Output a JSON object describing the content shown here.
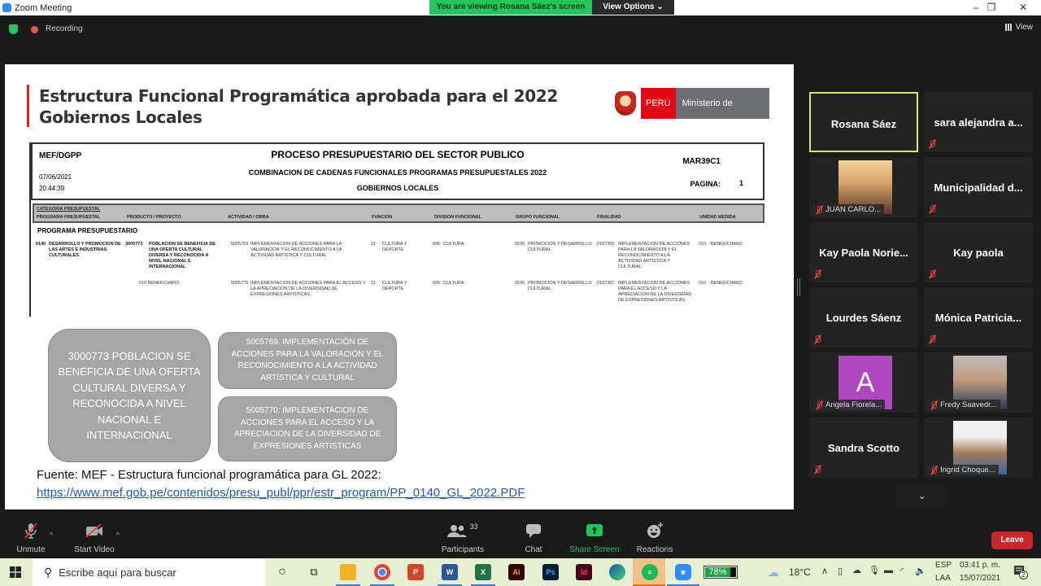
{
  "window": {
    "title": "Zoom Meeting",
    "minimize": "–",
    "restore": "❐",
    "close": "✕"
  },
  "banner": {
    "viewing": "You are viewing Rosana Sáez's screen",
    "view_options": "View Options ⌄"
  },
  "topbar": {
    "recording": "Recording",
    "view": "View"
  },
  "slide": {
    "title_line1": "Estructura Funcional Programática aprobada para el 2022",
    "title_line2": "Gobiernos Locales",
    "logo_peru": "PERÚ",
    "logo_ministry": "Ministerio de Cultura",
    "report": {
      "org": "MEF/DGPP",
      "date": "07/06/2021",
      "time": "20:44:39",
      "title": "PROCESO PRESUPUESTARIO DEL SECTOR PUBLICO",
      "subtitle": "COMBINACION DE CADENAS FUNCIONALES PROGRAMAS PRESUPUESTALES 2022",
      "subtitle2": "GOBIERNOS LOCALES",
      "code": "MAR39C1",
      "page_label": "PAGINA:",
      "page_number": "1"
    },
    "table_headers": {
      "categoria": "CATEGORIA PRESUPUESTAL",
      "programa": "PROGRAMA PRESUPUESTAL",
      "producto": "PRODUCTO / PROYECTO",
      "actividad": "ACTIVIDAD / OBRA",
      "funcion": "FUNCION",
      "division": "DIVISION FUNCIONAL",
      "grupo": "GRUPO FUNCIONAL",
      "finalidad": "FINALIDAD",
      "unidad": "UNIDAD MEDIDA"
    },
    "section_label": "PROGRAMA PRESUPUESTARIO",
    "rows": [
      {
        "prog_code": "0140",
        "prog_name": "DESARROLLO Y PROMOCION DE LAS ARTES E INDUSTRIAS CULTURALES",
        "prod_code": "3000773",
        "prod_name": "POBLACION SE BENEFICIA DE UNA OFERTA CULTURAL DIVERSA Y RECONOCIDA A NIVEL NACIONAL E INTERNACIONAL",
        "act_code": "5005769",
        "act_name": "IMPLEMENTACION DE ACCIONES PARA LA VALORACION Y EL RECONOCIMENTO A LA ACTIVIDAD ARTISTICA Y CULTURAL",
        "func_code": "21",
        "func_name": "CULTURA Y DEPORTE",
        "div_code": "045",
        "div_name": "CULTURA",
        "grp_code": "0100",
        "grp_name": "PROMOCION Y DESARROLLO CULTURAL",
        "fin_code": "0167390",
        "fin_name": "IMPLEMENTACION DE ACCIONES PARA LA VALORACION Y EL RECONOCIMIENTO A LA ACTIVIDAD ARTISTICA Y CULTURAL",
        "um_code": "010",
        "um_name": "BENEFICIARIO"
      },
      {
        "prod_extra": "010 BENEFICIARIO",
        "act_code": "5005770",
        "act_name": "IMPLEMENTACION DE ACCIONES PARA EL ACCESO Y LA APRECIACION DE LA DIVERSIDAD DE EXPRESIONES ARTISTICAS",
        "func_code": "21",
        "func_name": "CULTURA Y DEPORTE",
        "div_code": "045",
        "div_name": "CULTURA",
        "grp_code": "0100",
        "grp_name": "PROMOCION Y DESARROLLO CULTURAL",
        "fin_code": "0167391",
        "fin_name": "IMPLEMENTACION DE ACCIONES PARA EL ACCESO Y LA APRECIACION DE LA DIVERSIDAD DE EXPRESIONES ARTISTICAS",
        "um_code": "010",
        "um_name": "BENEFICIARIO"
      }
    ],
    "box_product": "3000773 POBLACION SE BENEFICIA DE UNA OFERTA CULTURAL DIVERSA Y RECONOCIDA A NIVEL NACIONAL E INTERNACIONAL",
    "box_act1": "5005769. IMPLEMENTACIÓN DE ACCIONES PARA LA VALORACIÓN Y EL RECONOCIMIENTO A LA ACTIVIDAD ARTÍSTICA Y CULTURAL",
    "box_act2": "5005770: IMPLEMENTACION DE ACCIONES PARA EL ACCESO Y LA APRECIACION DE LA DIVERSIDAD DE EXPRESIONES ARTISTICAS",
    "source_text": "Fuente: MEF - Estructura funcional programática para GL 2022:",
    "source_link": "https://www.mef.gob.pe/contenidos/presu_publ/ppr/estr_program/PP_0140_GL_2022.PDF"
  },
  "participants": [
    {
      "name": "Rosana Sáez",
      "type": "name",
      "active": true,
      "muted": false
    },
    {
      "name": "sara alejandra a...",
      "type": "name",
      "muted": true
    },
    {
      "name": "JUAN CARLO...",
      "type": "photo",
      "muted": true
    },
    {
      "name": "Municipalidad d...",
      "type": "name",
      "muted": true
    },
    {
      "name": "Kay Paola Norie...",
      "type": "name",
      "muted": true
    },
    {
      "name": "Kay paola",
      "type": "name",
      "muted": true
    },
    {
      "name": "Lourdes Sáenz",
      "type": "name",
      "muted": true
    },
    {
      "name": "Mónica Patricia...",
      "type": "name",
      "muted": true
    },
    {
      "name": "Angela Fiorela...",
      "type": "avatar",
      "initial": "A",
      "muted": true
    },
    {
      "name": "Fredy Saavedr...",
      "type": "photo",
      "muted": true
    },
    {
      "name": "Sandra Scotto",
      "type": "name",
      "muted": true
    },
    {
      "name": "Ingrid Choque...",
      "type": "photo",
      "muted": true
    }
  ],
  "more_participants": "⌄",
  "toolbar": {
    "unmute": "Unmute",
    "start_video": "Start Video",
    "participants": "Participants",
    "participants_count": "33",
    "chat": "Chat",
    "share_screen": "Share Screen",
    "reactions": "Reactions",
    "leave": "Leave",
    "caret": "^"
  },
  "taskbar": {
    "search_placeholder": "Escribe aquí para buscar",
    "battery": "78%",
    "temperature": "18°C",
    "lang1": "ESP",
    "lang2": "LAA",
    "time": "03:41 p. m.",
    "date": "15/07/2021",
    "notifications": "2"
  },
  "colors": {
    "accent_green": "#22c55e",
    "leave_red": "#c8282a",
    "active_border": "#d7e86a",
    "peru_red": "#e30613"
  }
}
